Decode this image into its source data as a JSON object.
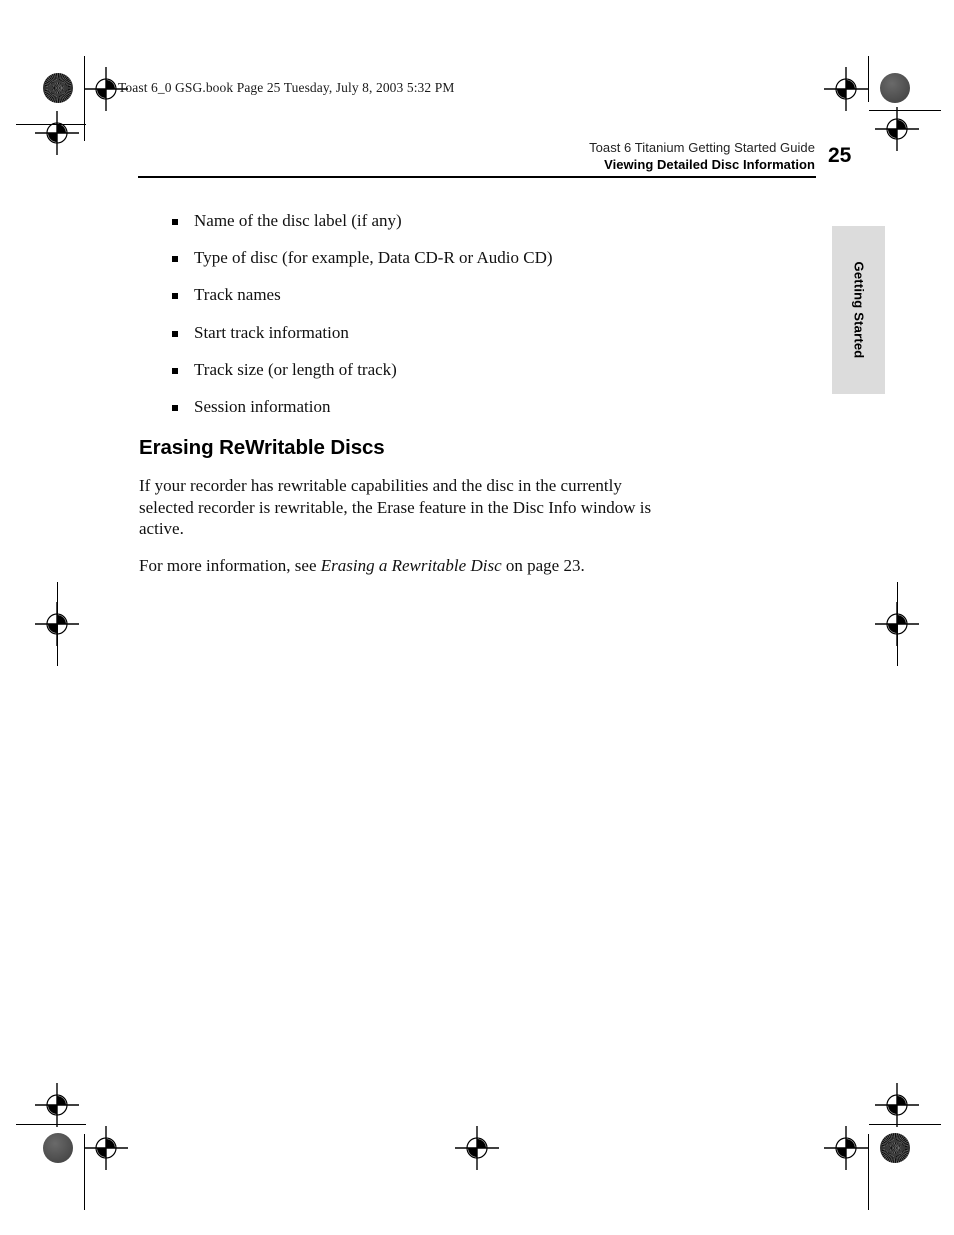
{
  "document": {
    "file_info": "Toast 6_0 GSG.book  Page 25  Tuesday, July 8, 2003  5:32 PM",
    "running_header": {
      "guide_title": "Toast 6 Titanium Getting Started Guide",
      "section_title": "Viewing Detailed Disc Information"
    },
    "page_number": "25",
    "side_tab": {
      "label": "Getting Started",
      "background_color": "#dcdcdc"
    }
  },
  "content": {
    "bullets": [
      "Name of the disc label (if any)",
      "Type of disc (for example, Data CD-R or Audio CD)",
      "Track names",
      "Start track information",
      "Track size (or length of track)",
      "Session information"
    ],
    "section": {
      "heading": "Erasing ReWritable Discs",
      "paragraph_1": "If your recorder has rewritable capabilities and the disc in the currently selected recorder is rewritable, the Erase feature in the Disc Info window is active.",
      "cross_reference": {
        "lead_in": "For more information, see ",
        "italic_title": "Erasing a Rewritable Disc",
        "trailing": " on page 23."
      }
    }
  },
  "print_marks": {
    "registration_icon": "registration-target-icon",
    "halftone_patch_icon": "halftone-density-patch-icon",
    "solid_patch_icon": "solid-density-patch-icon"
  }
}
